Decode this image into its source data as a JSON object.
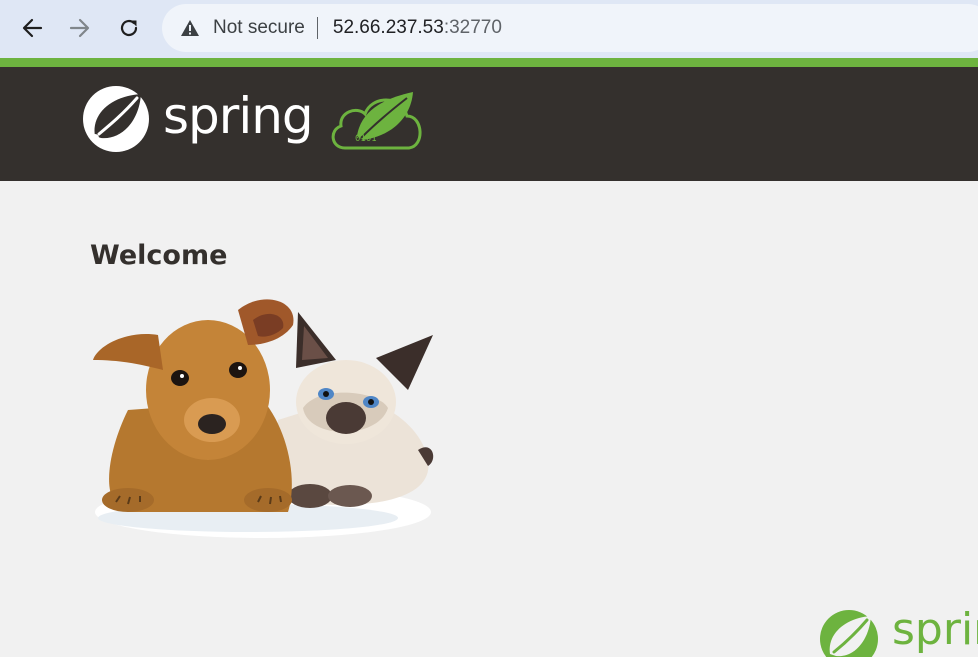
{
  "browser": {
    "security_label": "Not secure",
    "url_host": "52.66.237.53",
    "url_port": ":32770",
    "icons": {
      "back": "arrow-left-icon",
      "forward": "arrow-right-icon",
      "reload": "reload-icon",
      "security": "warning-triangle-icon"
    }
  },
  "header": {
    "brand_text": "spring",
    "cloud_digits": "0101"
  },
  "main": {
    "title": "Welcome",
    "image_subject": "puppy and kitten"
  },
  "footer": {
    "brand_text": "spring"
  },
  "colors": {
    "accent_green": "#6db33f",
    "header_dark": "#34302d",
    "page_bg": "#f1f1f1",
    "browser_bar": "#dfe7f5"
  }
}
